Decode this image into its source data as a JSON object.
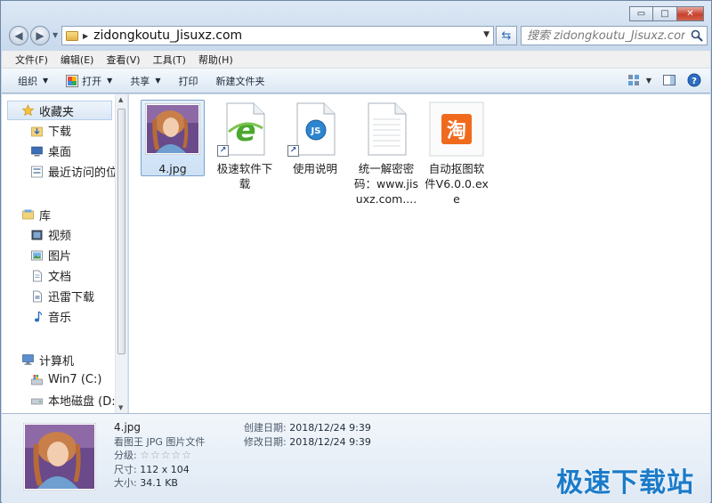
{
  "window": {
    "minimize": "▭",
    "maximize": "□",
    "close": "✕"
  },
  "address": {
    "path": "zidongkoutu_Jisuxz.com",
    "search_placeholder": "搜索 zidongkoutu_Jisuxz.com"
  },
  "menu": [
    "文件(F)",
    "编辑(E)",
    "查看(V)",
    "工具(T)",
    "帮助(H)"
  ],
  "toolbar": {
    "organize": "组织",
    "open": "打开",
    "share": "共享",
    "print": "打印",
    "new_folder": "新建文件夹"
  },
  "nav": {
    "favorites": "收藏夹",
    "fav_items": [
      "下载",
      "桌面",
      "最近访问的位"
    ],
    "libraries": "库",
    "lib_items": [
      "视频",
      "图片",
      "文档",
      "迅雷下载",
      "音乐"
    ],
    "computer": "计算机",
    "comp_items": [
      "Win7 (C:)",
      "本地磁盘 (D:"
    ]
  },
  "files": [
    {
      "name": "4.jpg",
      "type": "photo",
      "selected": true
    },
    {
      "name": "极速软件下载",
      "type": "ie-shortcut"
    },
    {
      "name": "使用说明",
      "type": "js-shortcut"
    },
    {
      "name": "统一解密密码：www.jisuxz.com....",
      "type": "text-document"
    },
    {
      "name": "自动抠图软件V6.0.0.exe",
      "type": "taobao-app"
    }
  ],
  "details": {
    "name": "4.jpg",
    "type_label": "看图王 JPG 图片文件",
    "rating_label": "分级:",
    "stars": "☆☆☆☆☆",
    "size_label": "尺寸:",
    "size_value": "112 x 104",
    "filesize_label": "大小:",
    "filesize_value": "34.1 KB",
    "created_label": "创建日期:",
    "created_value": "2018/12/24 9:39",
    "modified_label": "修改日期:",
    "modified_value": "2018/12/24 9:39"
  },
  "watermark": "极速下载站",
  "colors": {
    "accent": "#1b7bc9",
    "selection": "#cde1f6",
    "taobao_orange": "#ef6a1d"
  }
}
